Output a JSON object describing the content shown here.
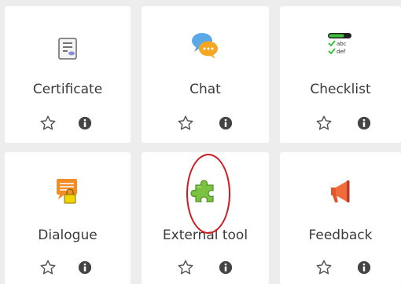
{
  "activities": [
    {
      "name": "Certificate",
      "icon": "certificate-icon"
    },
    {
      "name": "Chat",
      "icon": "chat-icon"
    },
    {
      "name": "Checklist",
      "icon": "checklist-icon"
    },
    {
      "name": "Dialogue",
      "icon": "dialogue-icon"
    },
    {
      "name": "External tool",
      "icon": "puzzle-icon"
    },
    {
      "name": "Feedback",
      "icon": "megaphone-icon"
    }
  ],
  "colors": {
    "star_outline": "#555555",
    "info_fill": "#444444",
    "highlight": "#d0181f"
  }
}
